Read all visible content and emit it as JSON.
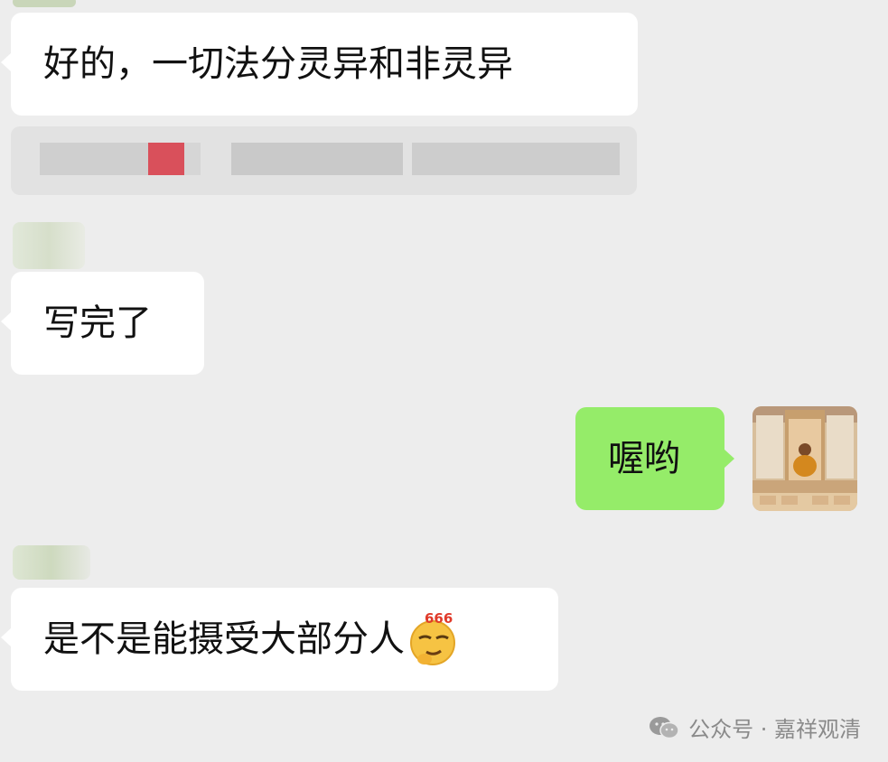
{
  "messages": [
    {
      "text": "好的，一切法分灵异和非灵异"
    },
    {
      "text": "写完了"
    },
    {
      "text": "喔哟"
    },
    {
      "text": "是不是能摄受大部分人"
    }
  ],
  "sticker": {
    "label": "666"
  },
  "watermark": {
    "text": "公众号 · 嘉祥观清"
  },
  "icons": [
    "wechat-icon",
    "emoji-icon"
  ],
  "colors": {
    "background": "#ededed",
    "incoming_bubble": "#ffffff",
    "outgoing_bubble": "#95ec69"
  }
}
